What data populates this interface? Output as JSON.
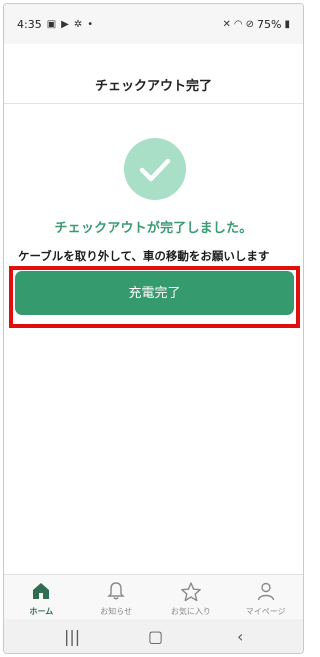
{
  "status_bar": {
    "time": "4:35",
    "battery": "75%"
  },
  "header": {
    "title": "チェックアウト完了"
  },
  "main": {
    "complete_message": "チェックアウトが完了しました。",
    "instructions": "ケーブルを取り外して、車の移動をお願いします",
    "button_label": "充電完了"
  },
  "bottom_nav": {
    "items": [
      {
        "label": "ホーム",
        "icon": "home-icon",
        "active": true
      },
      {
        "label": "お知らせ",
        "icon": "bell-icon",
        "active": false
      },
      {
        "label": "お気に入り",
        "icon": "star-icon",
        "active": false
      },
      {
        "label": "マイページ",
        "icon": "person-icon",
        "active": false
      }
    ]
  },
  "colors": {
    "accent": "#359a6d",
    "accent_text": "#3a9a72",
    "check_circle": "#a8dfc6",
    "highlight": "#e10e0e"
  }
}
